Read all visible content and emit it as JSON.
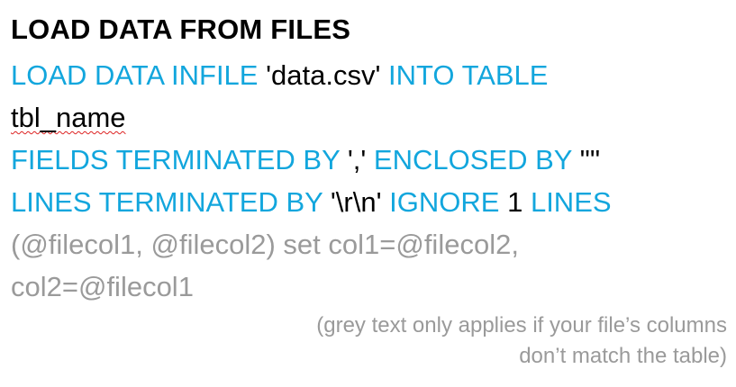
{
  "title": "LOAD DATA FROM FILES",
  "lines": {
    "l1_kw1": "LOAD DATA INFILE",
    "l1_lit1": "'data.csv'",
    "l1_kw2": "INTO TABLE",
    "l2_ident": "tbl_name",
    "l3_kw1": "FIELDS TERMINATED BY",
    "l3_lit1": "','",
    "l3_kw2": "ENCLOSED BY",
    "l3_lit2": "'\"'",
    "l4_kw1": "LINES TERMINATED BY",
    "l4_lit1": "'\\r\\n'",
    "l4_kw2": "IGNORE",
    "l4_lit2": "1",
    "l4_kw3": "LINES",
    "l5_grey": "(@filecol1, @filecol2) set col1=@filecol2,",
    "l6_grey": "col2=@filecol1"
  },
  "note": {
    "line1": "(grey text only applies if your file’s columns",
    "line2": "don’t match the table)"
  },
  "colors": {
    "keyword": "#12a6dd",
    "literal": "#000000",
    "optional": "#9a9a9a"
  }
}
